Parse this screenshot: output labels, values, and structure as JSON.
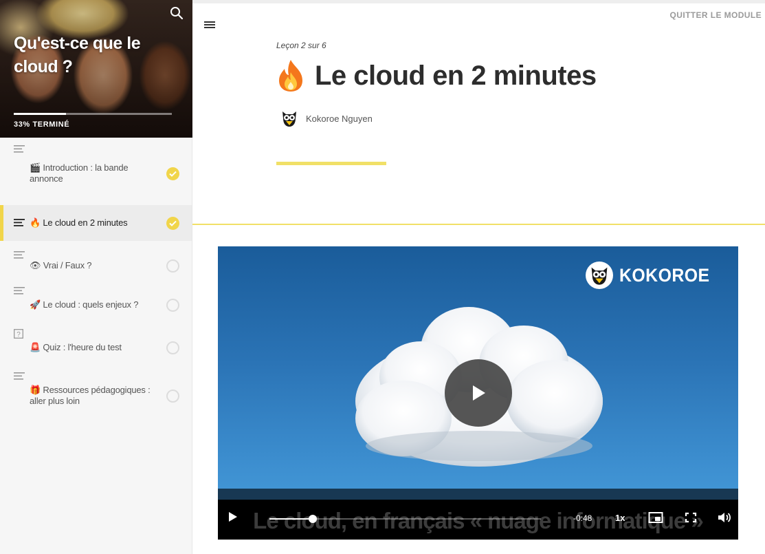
{
  "course": {
    "title": "Qu'est-ce que le cloud ?",
    "progress_percent": 33,
    "progress_label": "33% TERMINÉ"
  },
  "lessons": [
    {
      "emoji": "🎬",
      "label": "🎬 Introduction : la bande annonce",
      "status": "done",
      "icon": "text-lines-icon"
    },
    {
      "emoji": "🔥",
      "label": "🔥 Le cloud en 2 minutes",
      "status": "done",
      "icon": "text-lines-icon",
      "active": true
    },
    {
      "emoji": "👁",
      "label": "👁 Vrai / Faux ?",
      "status": "todo",
      "icon": "text-lines-icon"
    },
    {
      "emoji": "🚀",
      "label": "🚀 Le cloud : quels enjeux ?",
      "status": "todo",
      "icon": "text-lines-icon"
    },
    {
      "emoji": "🚨",
      "label": "🚨 Quiz : l'heure du test",
      "status": "todo",
      "icon": "quiz-question-icon"
    },
    {
      "emoji": "🎁",
      "label": "🎁 Ressources pédagogiques : aller plus loin",
      "status": "todo",
      "icon": "text-lines-icon"
    }
  ],
  "header": {
    "exit_label": "QUITTER LE MODULE"
  },
  "lesson": {
    "counter": "Leçon 2 sur 6",
    "title": "Le cloud en 2 minutes",
    "title_icon": "fire-icon",
    "author": "Kokoroe Nguyen"
  },
  "video": {
    "brand": "KOKOROE",
    "caption": "Le cloud, en français « nuage informatique »",
    "time_remaining": "-0:48",
    "speed": "1x",
    "played_fraction": 0.16
  },
  "colors": {
    "accent": "#f1d54a",
    "accent_line": "#f1e067",
    "text_dark": "#2d2d2d"
  }
}
